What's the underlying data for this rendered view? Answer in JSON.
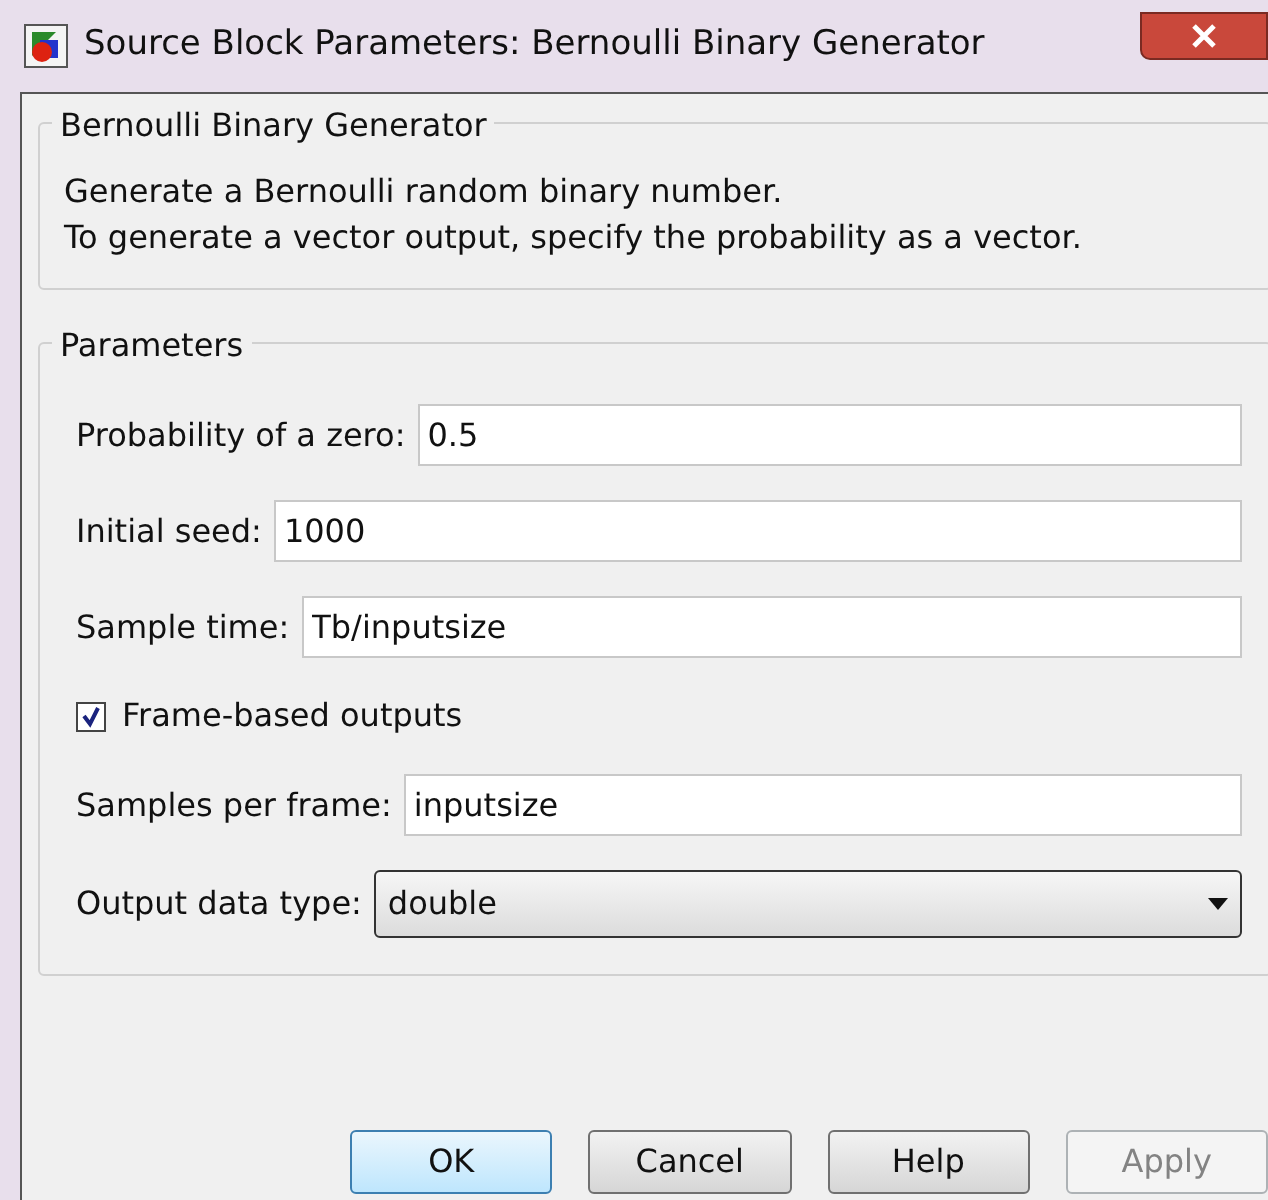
{
  "window": {
    "title": "Source Block Parameters: Bernoulli Binary Generator"
  },
  "description": {
    "title": "Bernoulli Binary Generator",
    "lines": [
      "Generate a Bernoulli random binary number.",
      "To generate a vector output, specify the probability as a vector."
    ]
  },
  "parameters": {
    "title": "Parameters",
    "items": [
      {
        "kind": "text",
        "label": "Probability of a zero:",
        "value": "0.5"
      },
      {
        "kind": "text",
        "label": "Initial seed:",
        "value": "1000"
      },
      {
        "kind": "text",
        "label": "Sample time:",
        "value": "Tb/inputsize"
      },
      {
        "kind": "checkbox",
        "label": "Frame-based outputs",
        "checked": true
      },
      {
        "kind": "text",
        "label": "Samples per frame:",
        "value": "inputsize"
      },
      {
        "kind": "dropdown",
        "label": "Output data type:",
        "value": "double"
      }
    ]
  },
  "buttons": [
    {
      "label": "OK",
      "default": true,
      "disabled": false
    },
    {
      "label": "Cancel",
      "default": false,
      "disabled": false
    },
    {
      "label": "Help",
      "default": false,
      "disabled": false
    },
    {
      "label": "Apply",
      "default": false,
      "disabled": true
    }
  ]
}
